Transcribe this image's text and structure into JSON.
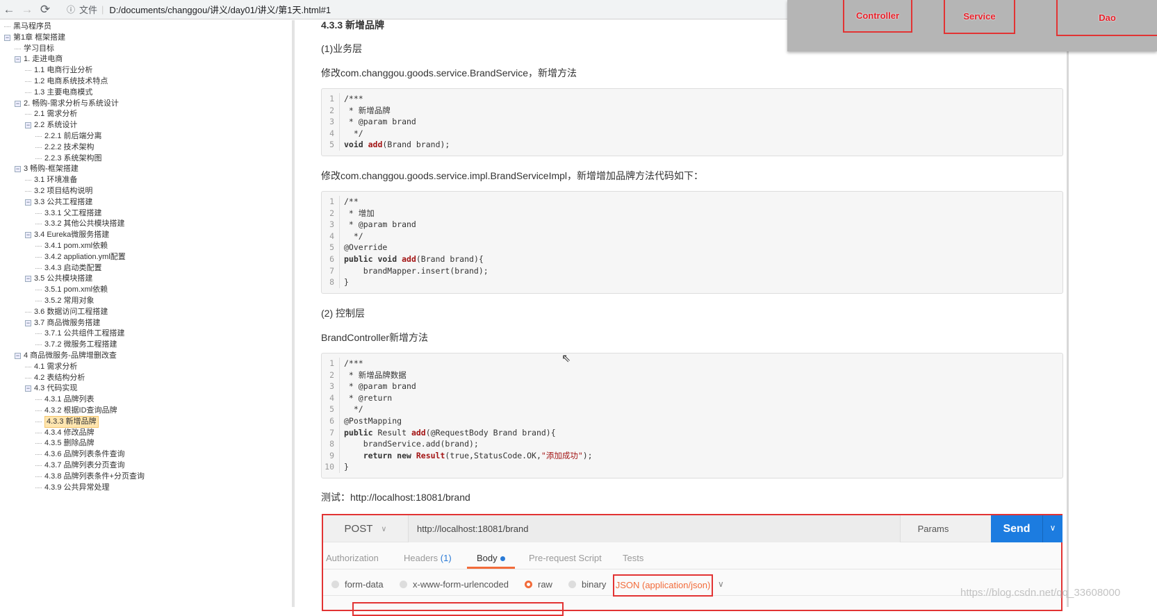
{
  "browser": {
    "back_icon": "←",
    "forward_icon": "→",
    "reload_icon": "⟳",
    "info_icon": "ⓘ",
    "file_label": "文件",
    "url": "D:/documents/changgou/讲义/day01/讲义/第1天.html#1"
  },
  "sidebar": {
    "items": [
      {
        "level": 0,
        "toggle": false,
        "label": "黑马程序员"
      },
      {
        "level": 0,
        "toggle": true,
        "label": "第1章 框架搭建"
      },
      {
        "level": 1,
        "toggle": false,
        "label": "学习目标"
      },
      {
        "level": 1,
        "toggle": true,
        "label": "1. 走进电商"
      },
      {
        "level": 2,
        "toggle": false,
        "label": "1.1 电商行业分析"
      },
      {
        "level": 2,
        "toggle": false,
        "label": "1.2 电商系统技术特点"
      },
      {
        "level": 2,
        "toggle": false,
        "label": "1.3 主要电商模式"
      },
      {
        "level": 1,
        "toggle": true,
        "label": "2. 畅购-需求分析与系统设计"
      },
      {
        "level": 2,
        "toggle": false,
        "label": "2.1 需求分析"
      },
      {
        "level": 2,
        "toggle": true,
        "label": "2.2 系统设计"
      },
      {
        "level": 3,
        "toggle": false,
        "label": "2.2.1 前后端分离"
      },
      {
        "level": 3,
        "toggle": false,
        "label": "2.2.2 技术架构"
      },
      {
        "level": 3,
        "toggle": false,
        "label": "2.2.3 系统架构图"
      },
      {
        "level": 1,
        "toggle": true,
        "label": "3 畅购-框架搭建"
      },
      {
        "level": 2,
        "toggle": false,
        "label": "3.1 环境准备"
      },
      {
        "level": 2,
        "toggle": false,
        "label": "3.2 项目结构说明"
      },
      {
        "level": 2,
        "toggle": true,
        "label": "3.3 公共工程搭建"
      },
      {
        "level": 3,
        "toggle": false,
        "label": "3.3.1 父工程搭建"
      },
      {
        "level": 3,
        "toggle": false,
        "label": "3.3.2 其他公共模块搭建"
      },
      {
        "level": 2,
        "toggle": true,
        "label": "3.4 Eureka微服务搭建"
      },
      {
        "level": 3,
        "toggle": false,
        "label": "3.4.1 pom.xml依赖"
      },
      {
        "level": 3,
        "toggle": false,
        "label": "3.4.2 appliation.yml配置"
      },
      {
        "level": 3,
        "toggle": false,
        "label": "3.4.3 启动类配置"
      },
      {
        "level": 2,
        "toggle": true,
        "label": "3.5 公共模块搭建"
      },
      {
        "level": 3,
        "toggle": false,
        "label": "3.5.1 pom.xml依赖"
      },
      {
        "level": 3,
        "toggle": false,
        "label": "3.5.2 常用对象"
      },
      {
        "level": 2,
        "toggle": false,
        "label": "3.6 数据访问工程搭建"
      },
      {
        "level": 2,
        "toggle": true,
        "label": "3.7 商品微服务搭建"
      },
      {
        "level": 3,
        "toggle": false,
        "label": "3.7.1 公共组件工程搭建"
      },
      {
        "level": 3,
        "toggle": false,
        "label": "3.7.2 微服务工程搭建"
      },
      {
        "level": 1,
        "toggle": true,
        "label": "4 商品微服务-品牌增删改查"
      },
      {
        "level": 2,
        "toggle": false,
        "label": "4.1 需求分析"
      },
      {
        "level": 2,
        "toggle": false,
        "label": "4.2 表结构分析"
      },
      {
        "level": 2,
        "toggle": true,
        "label": "4.3 代码实现"
      },
      {
        "level": 3,
        "toggle": false,
        "label": "4.3.1 品牌列表"
      },
      {
        "level": 3,
        "toggle": false,
        "label": "4.3.2 根据ID查询品牌"
      },
      {
        "level": 3,
        "toggle": false,
        "label": "4.3.3 新增品牌",
        "selected": true
      },
      {
        "level": 3,
        "toggle": false,
        "label": "4.3.4 修改品牌"
      },
      {
        "level": 3,
        "toggle": false,
        "label": "4.3.5 删除品牌"
      },
      {
        "level": 3,
        "toggle": false,
        "label": "4.3.6 品牌列表条件查询"
      },
      {
        "level": 3,
        "toggle": false,
        "label": "4.3.7 品牌列表分页查询"
      },
      {
        "level": 3,
        "toggle": false,
        "label": "4.3.8 品牌列表条件+分页查询"
      },
      {
        "level": 3,
        "toggle": false,
        "label": "4.3.9 公共异常处理"
      }
    ]
  },
  "main": {
    "heading": "4.3.3 新增品牌",
    "p1": "(1)业务层",
    "p2": "修改com.changgou.goods.service.BrandService，新增方法",
    "p3": "修改com.changgou.goods.service.impl.BrandServiceImpl，新增增加品牌方法代码如下：",
    "p4": "(2) 控制层",
    "p5": "BrandController新增方法",
    "p6": "测试：http://localhost:18081/brand",
    "code1": [
      [
        [
          "/***",
          ""
        ]
      ],
      [
        [
          " * 新增品牌",
          ""
        ]
      ],
      [
        [
          " * @param brand",
          ""
        ]
      ],
      [
        [
          "  */",
          ""
        ]
      ],
      [
        [
          "void ",
          "kw"
        ],
        [
          "add",
          "fn"
        ],
        [
          "(Brand brand);",
          ""
        ]
      ]
    ],
    "code2": [
      [
        [
          "/**",
          ""
        ]
      ],
      [
        [
          " * 增加",
          ""
        ]
      ],
      [
        [
          " * @param brand",
          ""
        ]
      ],
      [
        [
          "  */",
          ""
        ]
      ],
      [
        [
          "@Override",
          ""
        ]
      ],
      [
        [
          "public void ",
          "kw"
        ],
        [
          "add",
          "fn"
        ],
        [
          "(Brand brand){",
          ""
        ]
      ],
      [
        [
          "    brandMapper.insert(brand);",
          ""
        ]
      ],
      [
        [
          "}",
          ""
        ]
      ]
    ],
    "code3": [
      [
        [
          "/***",
          ""
        ]
      ],
      [
        [
          " * 新增品牌数据",
          ""
        ]
      ],
      [
        [
          " * @param brand",
          ""
        ]
      ],
      [
        [
          " * @return",
          ""
        ]
      ],
      [
        [
          "  */",
          ""
        ]
      ],
      [
        [
          "@PostMapping",
          ""
        ]
      ],
      [
        [
          "public ",
          "kw"
        ],
        [
          "Result ",
          ""
        ],
        [
          "add",
          "fn"
        ],
        [
          "(@RequestBody Brand brand){",
          ""
        ]
      ],
      [
        [
          "    brandService.add(brand);",
          ""
        ]
      ],
      [
        [
          "    return new ",
          "kw"
        ],
        [
          "Result",
          "fn"
        ],
        [
          "(true,StatusCode.OK,",
          ""
        ],
        [
          "\"添加成功\"",
          "str"
        ],
        [
          ");",
          ""
        ]
      ],
      [
        [
          "}",
          ""
        ]
      ]
    ]
  },
  "overlay": {
    "controller": "Controller",
    "service": "Service",
    "dao": "Dao"
  },
  "postman": {
    "method": "POST",
    "url": "http://localhost:18081/brand",
    "params": "Params",
    "send": "Send",
    "tabs": {
      "authorization": "Authorization",
      "headers": "Headers",
      "headers_count": "(1)",
      "body": "Body",
      "prerequest": "Pre-request Script",
      "tests": "Tests"
    },
    "body_types": {
      "form_data": "form-data",
      "urlencoded": "x-www-form-urlencoded",
      "raw": "raw",
      "binary": "binary",
      "selected": "raw"
    },
    "content_type": "JSON (application/json)"
  },
  "watermark": "https://blog.csdn.net/qq_33608000",
  "colors": {
    "accent": "#f26b3a",
    "send": "#1c7ce0",
    "highlight": "#e23333"
  }
}
